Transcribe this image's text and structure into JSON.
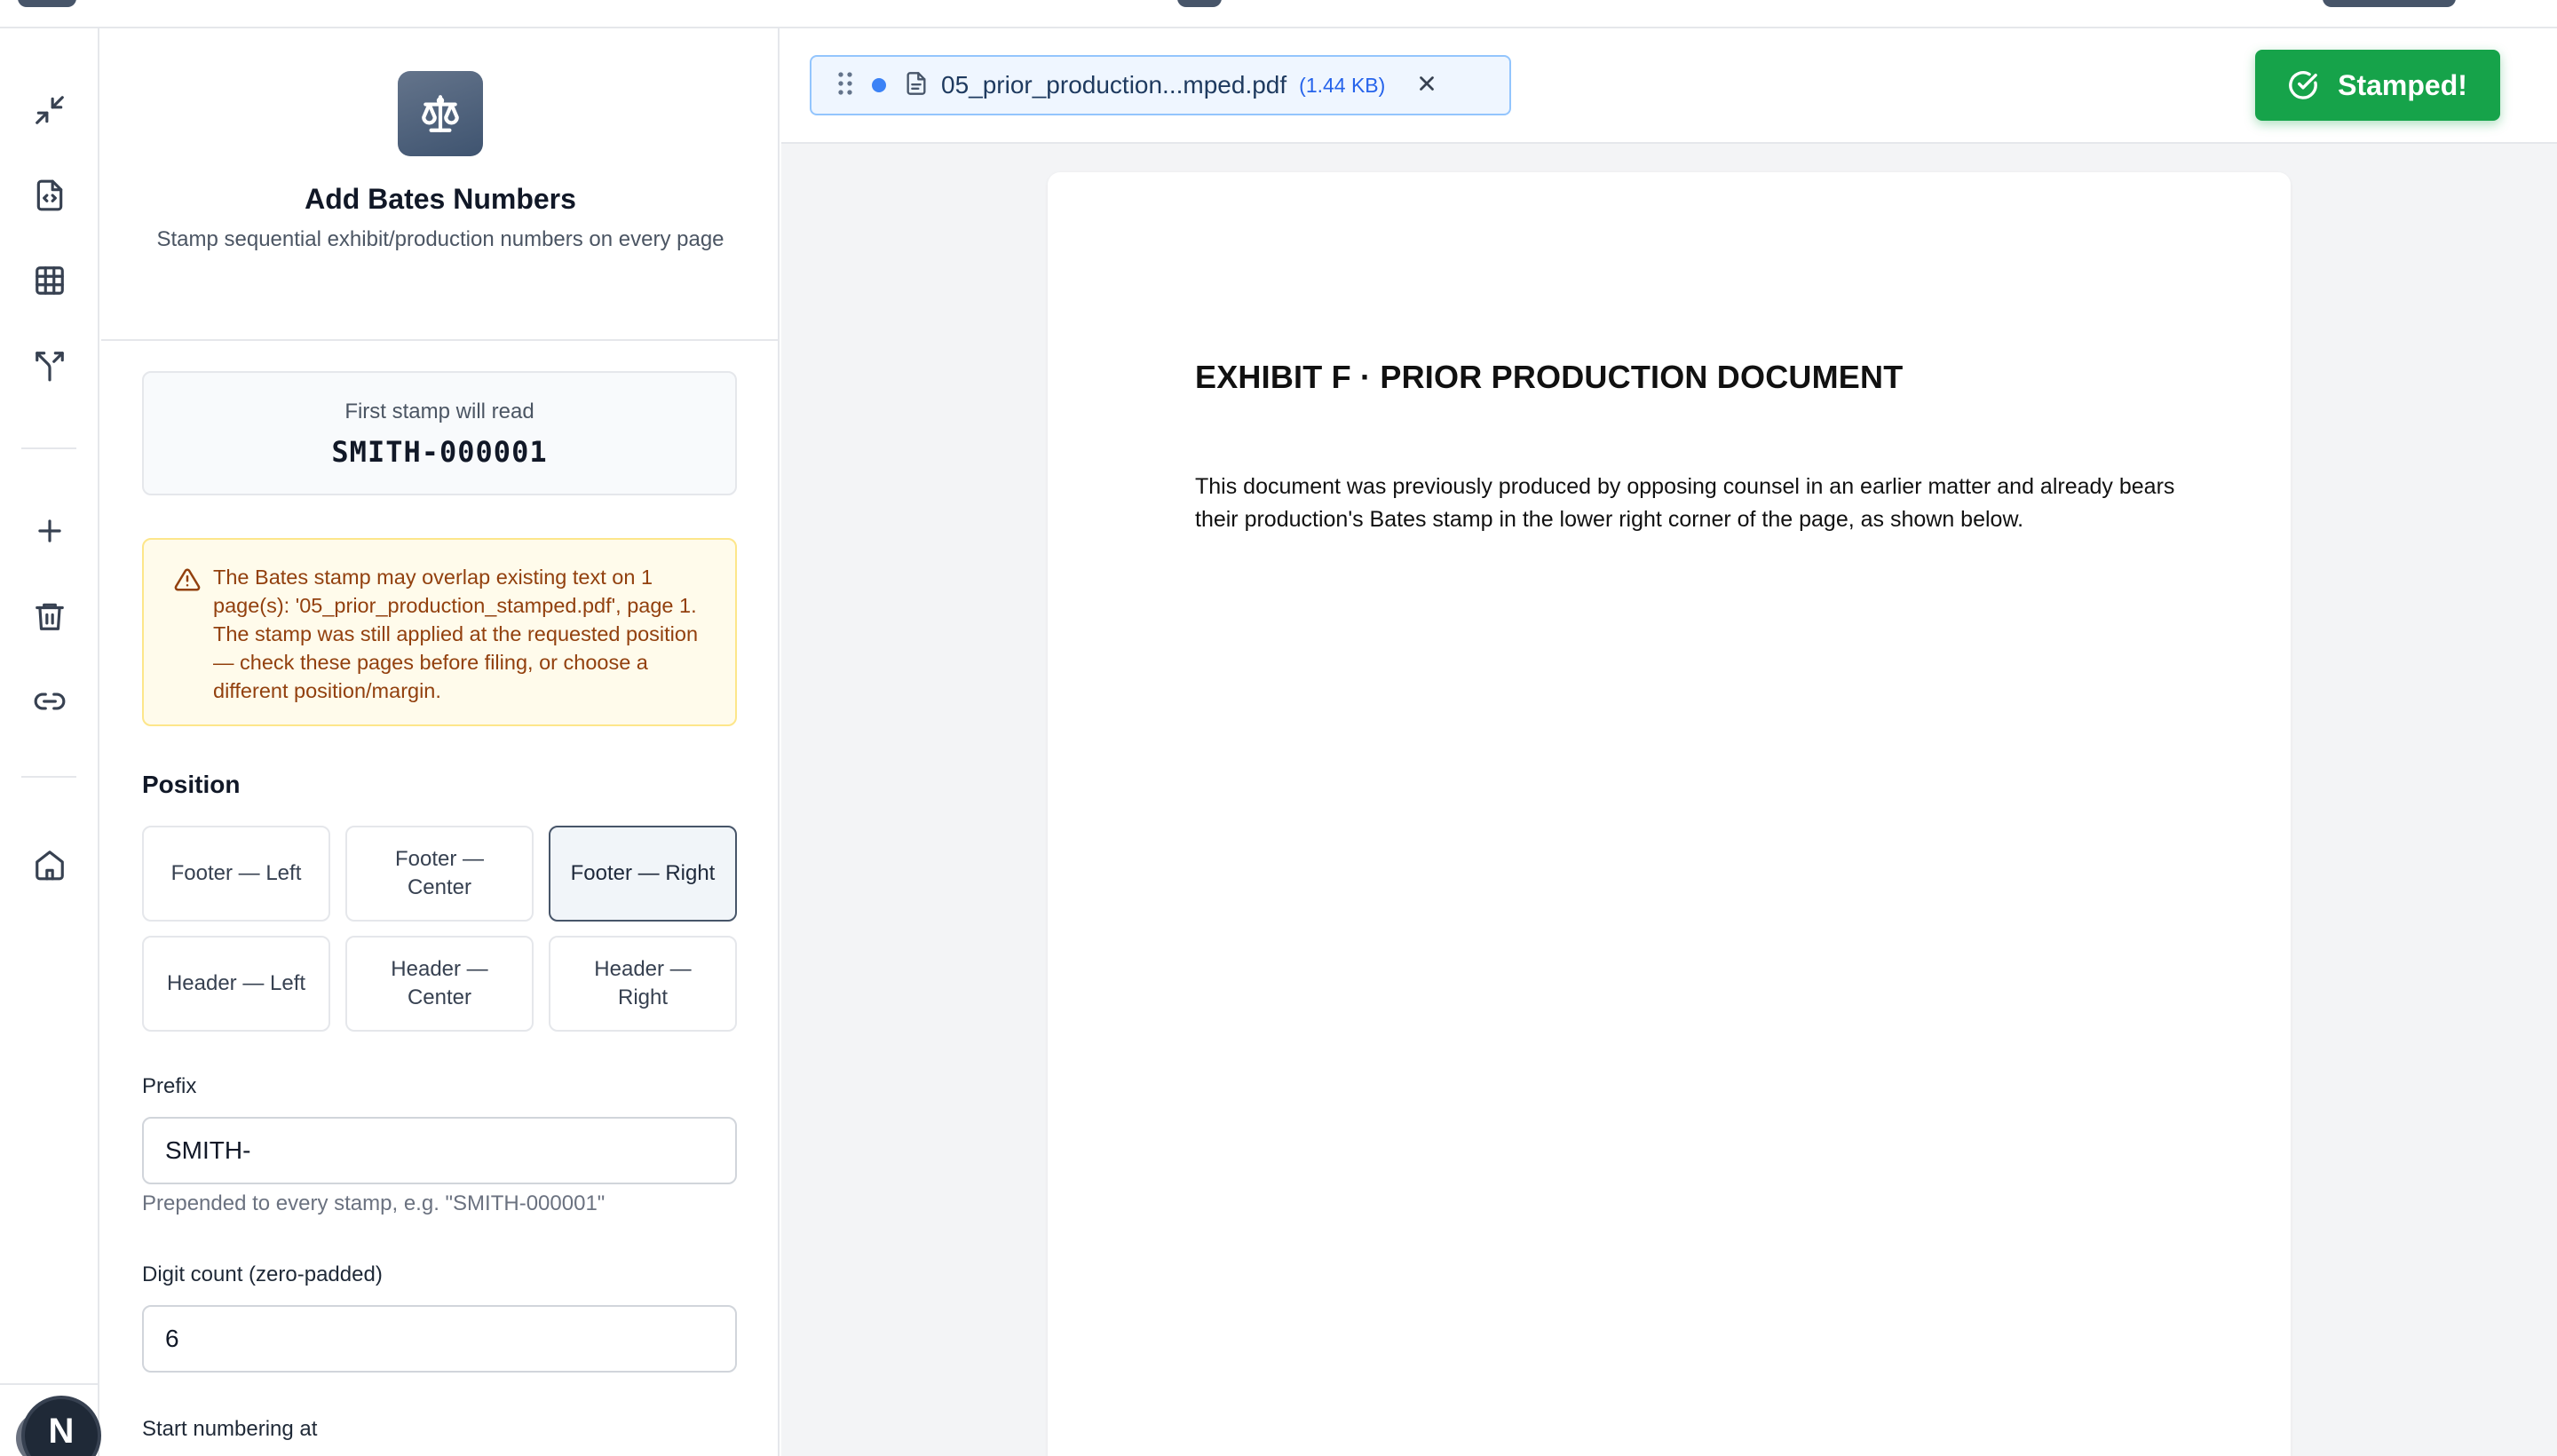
{
  "tool": {
    "title": "Add Bates Numbers",
    "description": "Stamp sequential exhibit/production numbers on every page"
  },
  "preview": {
    "label": "First stamp will read",
    "value": "SMITH-000001"
  },
  "warning": {
    "text": "The Bates stamp may overlap existing text on 1 page(s): '05_prior_production_stamped.pdf', page 1. The stamp was still applied at the requested position — check these pages before filing, or choose a different position/margin."
  },
  "position": {
    "title": "Position",
    "options": [
      {
        "label": "Footer — Left"
      },
      {
        "label": "Footer — Center"
      },
      {
        "label": "Footer — Right"
      },
      {
        "label": "Header — Left"
      },
      {
        "label": "Header — Center"
      },
      {
        "label": "Header — Right"
      }
    ],
    "selected": "Footer — Right"
  },
  "fields": {
    "prefix": {
      "label": "Prefix",
      "value": "SMITH-",
      "hint": "Prepended to every stamp, e.g. \"SMITH-000001\""
    },
    "digits": {
      "label": "Digit count (zero-padded)",
      "value": "6"
    },
    "start": {
      "label": "Start numbering at"
    }
  },
  "file": {
    "name": "05_prior_production...mped.pdf",
    "size": "(1.44 KB)"
  },
  "action": {
    "label": "Stamped!",
    "color": "#16a34a"
  },
  "document": {
    "heading": "EXHIBIT F · PRIOR PRODUCTION DOCUMENT",
    "body": "This document was previously produced by opposing counsel in an earlier matter and already bears their production's Bates stamp in the lower right corner of the page, as shown below."
  },
  "user": {
    "avatar_initial": "N"
  },
  "icons": {
    "rail": [
      "minimize-icon",
      "file-code-icon",
      "table-icon",
      "split-icon",
      "plus-icon",
      "trash-icon",
      "link-icon",
      "home-icon"
    ],
    "tool": "scale-icon"
  }
}
